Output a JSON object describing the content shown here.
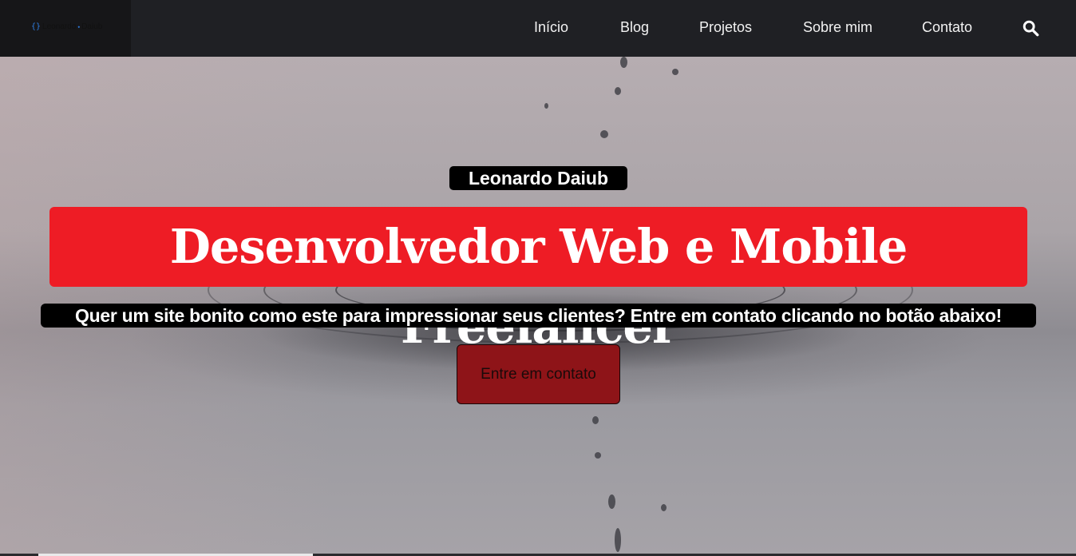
{
  "header": {
    "logo": {
      "text_left": "Leonardo",
      "text_right": "Daiub",
      "icon": "code-braces-icon"
    },
    "nav": [
      {
        "label": "Início"
      },
      {
        "label": "Blog"
      },
      {
        "label": "Projetos"
      },
      {
        "label": "Sobre mim"
      },
      {
        "label": "Contato"
      }
    ],
    "search_icon": "search-icon"
  },
  "hero": {
    "name": "Leonardo Daiub",
    "headline": "Desenvolvedor Web e Mobile Freelancer",
    "subline": "Quer um site bonito como este para impressionar seus clientes? Entre em contato clicando no botão abaixo!",
    "cta_label": "Entre em contato"
  },
  "colors": {
    "header_bg": "#1f2024",
    "headline_bg": "#ee1c25",
    "cta_bg": "#8e1418",
    "badge_bg": "#000000"
  }
}
